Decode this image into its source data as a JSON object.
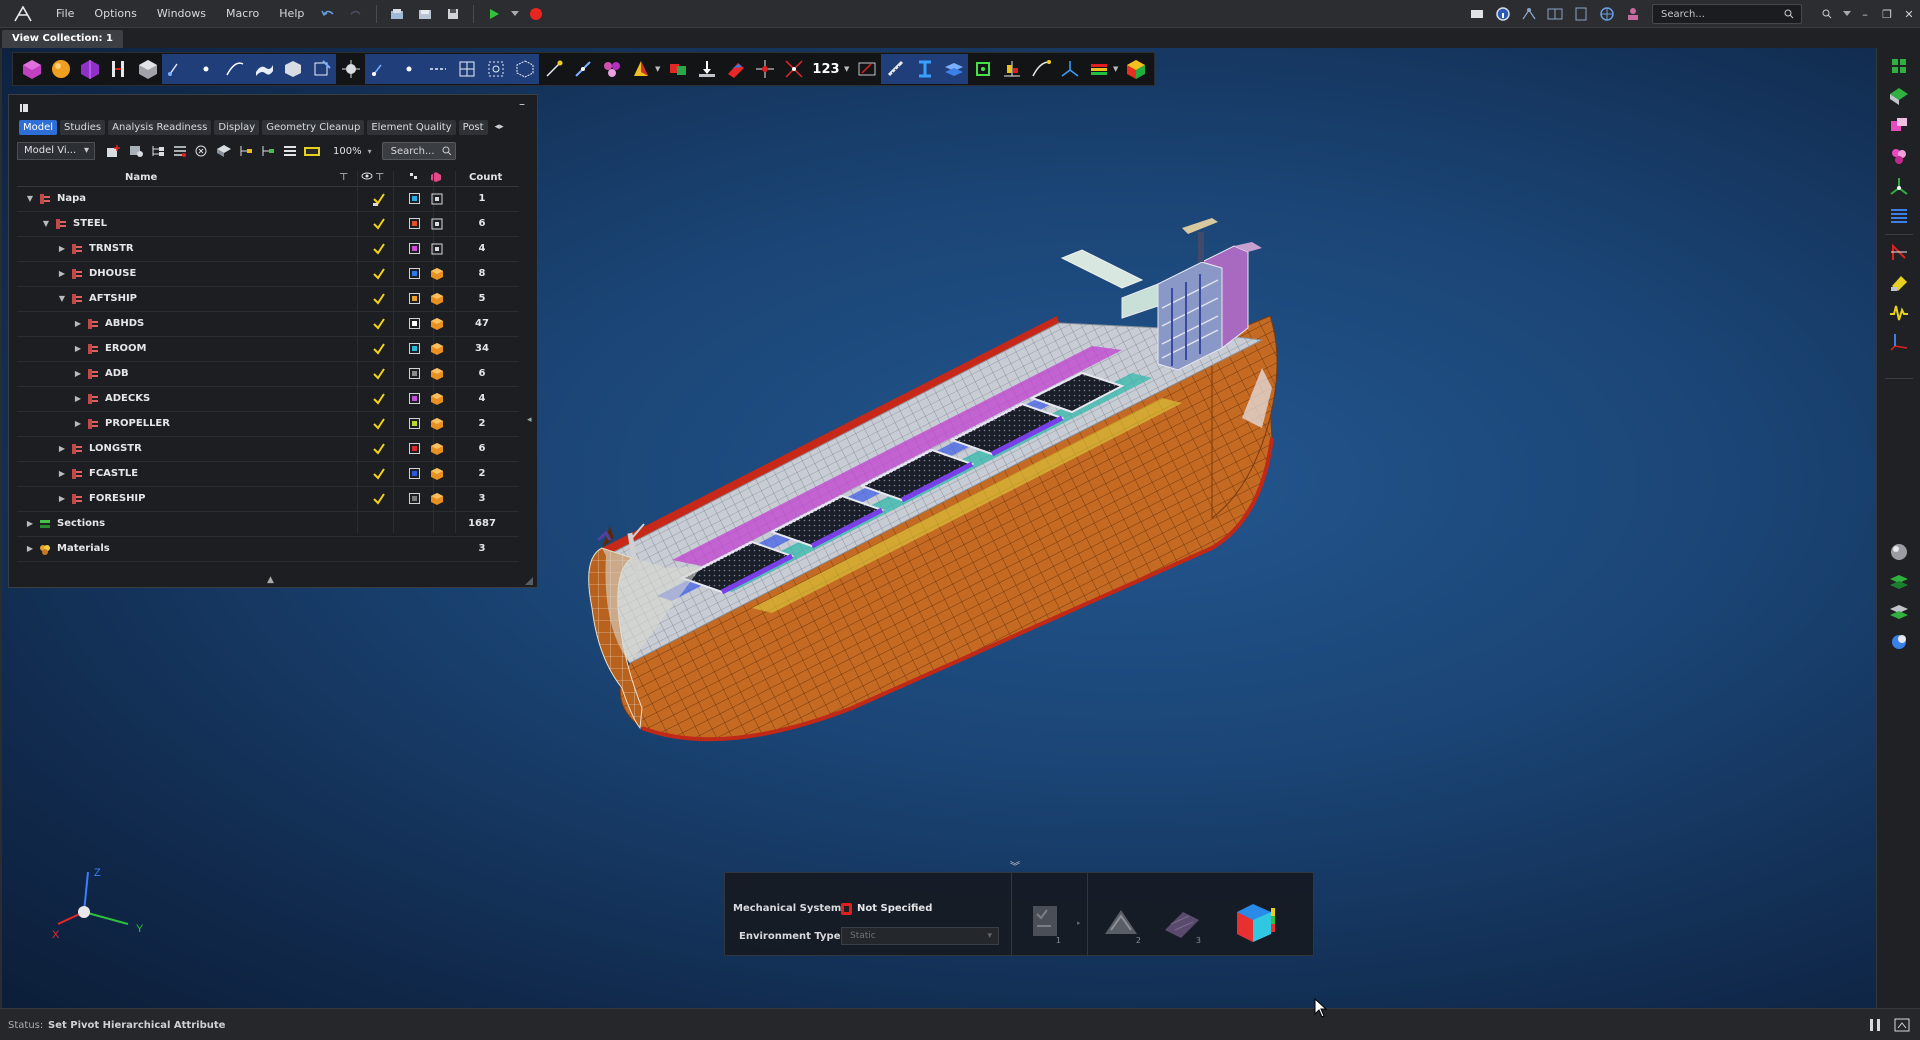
{
  "menu": {
    "items": [
      "File",
      "Options",
      "Windows",
      "Macro",
      "Help"
    ],
    "search_placeholder": "Search..."
  },
  "view_collection": {
    "tab_label": "View Collection: 1"
  },
  "ribbon": {
    "number_label": "123"
  },
  "model_browser": {
    "tabs": [
      "Model",
      "Studies",
      "Analysis Readiness",
      "Display",
      "Geometry Cleanup",
      "Element Quality",
      "Post"
    ],
    "active_tab": "Model",
    "view_select": "Model Vi...",
    "zoom": "100%",
    "search_placeholder": "Search...",
    "columns": {
      "name": "Name",
      "count": "Count"
    },
    "rows": [
      {
        "name": "Napa",
        "count": "1",
        "level": 0,
        "expanded": true,
        "color": "#2aa8e8",
        "check": "partial",
        "render": "wire"
      },
      {
        "name": "STEEL",
        "count": "6",
        "level": 1,
        "expanded": true,
        "color": "#e0502a",
        "check": "full",
        "render": "wire"
      },
      {
        "name": "TRNSTR",
        "count": "4",
        "level": 2,
        "expanded": false,
        "color": "#d04ad8",
        "check": "full",
        "render": "wire"
      },
      {
        "name": "DHOUSE",
        "count": "8",
        "level": 2,
        "expanded": false,
        "color": "#2a7be8",
        "check": "full",
        "render": "solid"
      },
      {
        "name": "AFTSHIP",
        "count": "5",
        "level": 2,
        "expanded": true,
        "color": "#e8a030",
        "check": "full",
        "render": "solid"
      },
      {
        "name": "ABHDS",
        "count": "47",
        "level": 3,
        "expanded": false,
        "color": "#ffffff",
        "check": "full",
        "render": "solid"
      },
      {
        "name": "EROOM",
        "count": "34",
        "level": 3,
        "expanded": false,
        "color": "#2ab8d8",
        "check": "full",
        "render": "solid"
      },
      {
        "name": "ADB",
        "count": "6",
        "level": 3,
        "expanded": false,
        "color": "#8a8a8a",
        "check": "full",
        "render": "solid"
      },
      {
        "name": "ADECKS",
        "count": "4",
        "level": 3,
        "expanded": false,
        "color": "#c050d8",
        "check": "full",
        "render": "solid"
      },
      {
        "name": "PROPELLER",
        "count": "2",
        "level": 3,
        "expanded": false,
        "color": "#b8d830",
        "check": "full",
        "render": "solid"
      },
      {
        "name": "LONGSTR",
        "count": "6",
        "level": 2,
        "expanded": false,
        "color": "#d82a2a",
        "check": "full",
        "render": "solid"
      },
      {
        "name": "FCASTLE",
        "count": "2",
        "level": 2,
        "expanded": false,
        "color": "#2a5ad8",
        "check": "full",
        "render": "solid"
      },
      {
        "name": "FORESHIP",
        "count": "3",
        "level": 2,
        "expanded": false,
        "color": "#7a7a7a",
        "check": "full",
        "render": "solid"
      },
      {
        "name": "Sections",
        "count": "1687",
        "level": 0,
        "expanded": false,
        "color": "",
        "check": "none",
        "render": "none",
        "icon": "sections"
      },
      {
        "name": "Materials",
        "count": "3",
        "level": 0,
        "expanded": false,
        "color": "",
        "check": "none",
        "render": "none",
        "icon": "materials"
      }
    ]
  },
  "axis": {
    "x": "X",
    "y": "Y",
    "z": "Z"
  },
  "guide_bar": {
    "mechanical_label": "Mechanical System:",
    "mechanical_value": "Not Specified",
    "environment_label": "Environment Type:",
    "environment_value": "Static",
    "steps": [
      "1",
      "2",
      "3"
    ]
  },
  "status": {
    "label": "Status:",
    "message": "Set Pivot Hierarchical Attribute"
  },
  "colors": {
    "viewport_bg": "#1a4474",
    "active_tab": "#2d6fd6",
    "hull": "#c46a22",
    "check": "#f2d21a"
  }
}
